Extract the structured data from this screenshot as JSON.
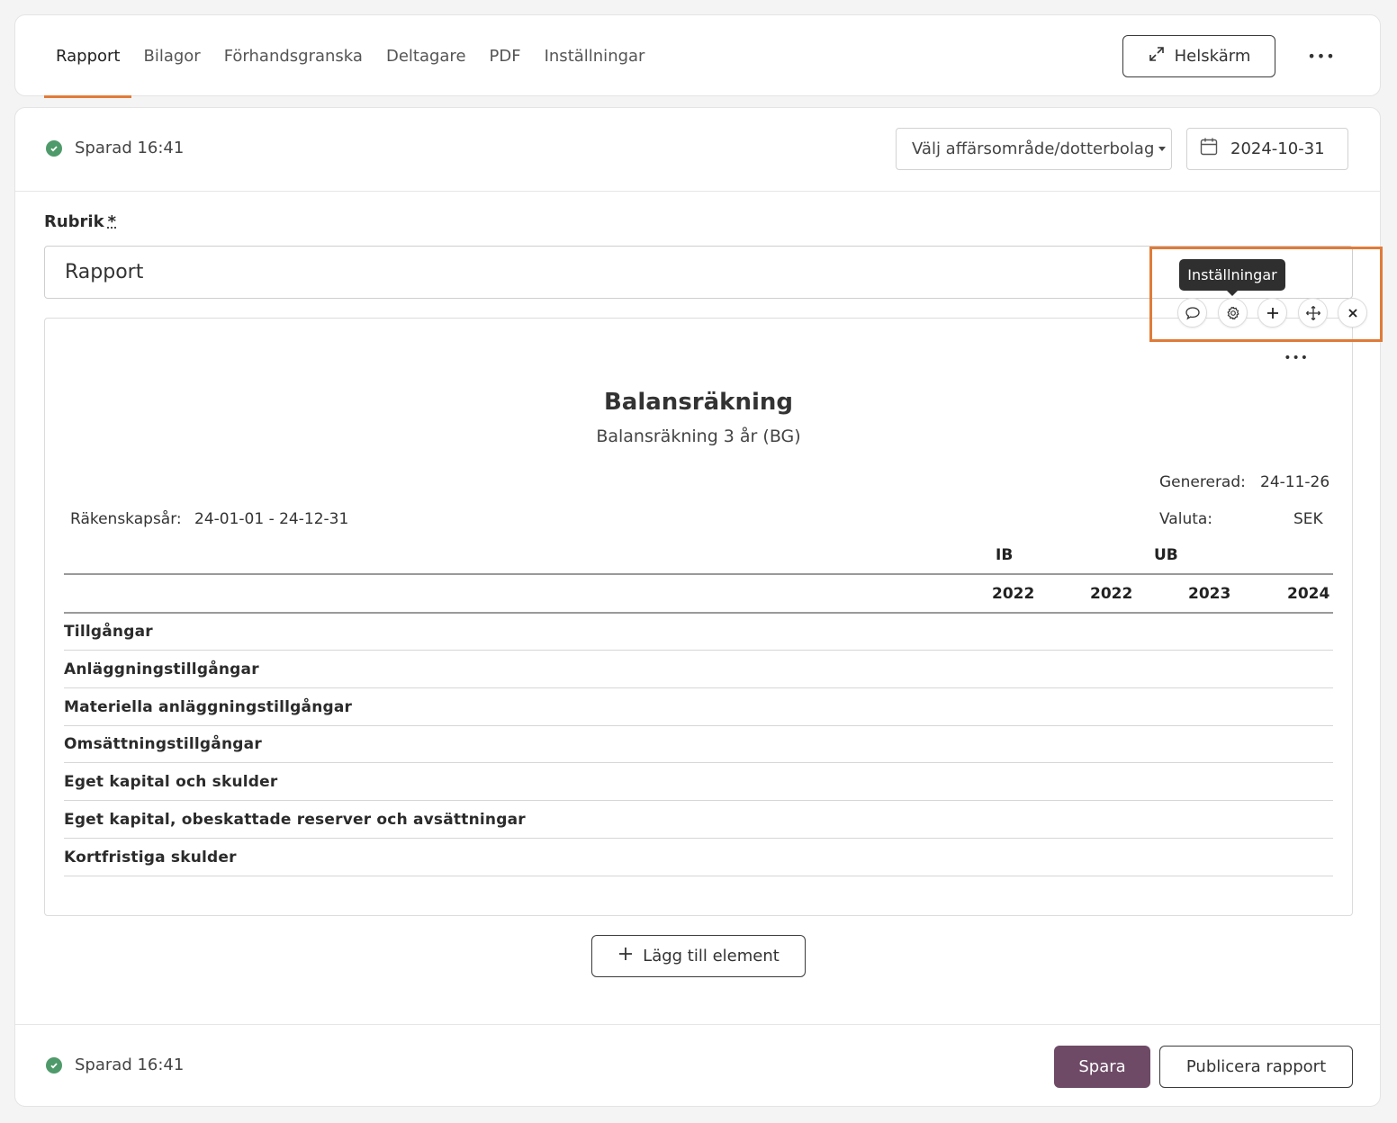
{
  "nav": {
    "tabs": [
      "Rapport",
      "Bilagor",
      "Förhandsgranska",
      "Deltagare",
      "PDF",
      "Inställningar"
    ],
    "active_tab": "Rapport",
    "fullscreen_label": "Helskärm",
    "more_label": "•••"
  },
  "status": {
    "saved_label": "Sparad 16:41"
  },
  "filters": {
    "business_area_placeholder": "Välj affärsområde/dotterbolag",
    "date_value": "2024-10-31"
  },
  "rubrik": {
    "label": "Rubrik",
    "required_mark": "*",
    "value": "Rapport"
  },
  "toolbar": {
    "tooltip": "Inställningar",
    "highlight_color": "#e07b39"
  },
  "report": {
    "title": "Balansräkning",
    "subtitle": "Balansräkning 3 år (BG)",
    "more_label": "•••",
    "generated_label": "Genererad:",
    "generated_value": "24-11-26",
    "fiscal_year_label": "Räkenskapsår:",
    "fiscal_year_value": "24-01-01 - 24-12-31",
    "currency_label": "Valuta:",
    "currency_value": "SEK",
    "group_headers": {
      "ib": "IB",
      "ub": "UB"
    },
    "years": [
      "2022",
      "2022",
      "2023",
      "2024"
    ],
    "rows": [
      "Tillgångar",
      "Anläggningstillgångar",
      "Materiella anläggningstillgångar",
      "Omsättningstillgångar",
      "Eget kapital och skulder",
      "Eget kapital, obeskattade reserver och avsättningar",
      "Kortfristiga skulder"
    ]
  },
  "actions": {
    "add_element": "Lägg till element",
    "save": "Spara",
    "publish": "Publicera rapport"
  },
  "colors": {
    "accent": "#e07b39",
    "primary": "#6e4a66",
    "success": "#4f9a6a"
  }
}
